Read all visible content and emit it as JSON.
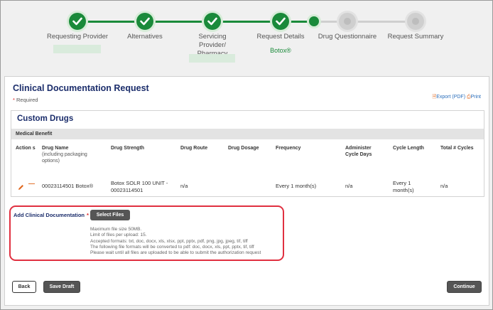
{
  "stepper": {
    "steps": [
      {
        "label": "Requesting Provider",
        "status": "done",
        "sub": ""
      },
      {
        "label": "Alternatives",
        "status": "done",
        "sub": ""
      },
      {
        "label": "Servicing Provider/ Pharmacy",
        "status": "done",
        "sub": ""
      },
      {
        "label": "Request Details",
        "status": "done",
        "sub": "Botox®"
      },
      {
        "label": "Drug Questionnaire",
        "status": "current",
        "sub": ""
      },
      {
        "label": "Request Summary",
        "status": "todo",
        "sub": ""
      }
    ]
  },
  "page": {
    "title": "Clinical Documentation Request",
    "required_note": "Required",
    "export_label": "Export (PDF)",
    "print_label": "Print"
  },
  "custom_drugs": {
    "title": "Custom Drugs",
    "benefit": "Medical Benefit",
    "columns": {
      "actions": "Action s",
      "drug_name": "Drug Name",
      "drug_name_note": "(including packaging options)",
      "strength": "Drug Strength",
      "route": "Drug Route",
      "dosage": "Drug Dosage",
      "frequency": "Frequency",
      "administer": "Administer Cycle Days",
      "cycle_length": "Cycle Length",
      "total_cycles": "Total # Cycles"
    },
    "row": {
      "drug_name": "00023114501 Botox®",
      "strength": "Botox SOLR 100 UNIT - 00023114501",
      "route": "n/a",
      "dosage": "",
      "frequency": "Every 1 month(s)",
      "administer": "n/a",
      "cycle_length": "Every 1 month(s)",
      "total_cycles": "n/a"
    }
  },
  "upload": {
    "label": "Add Clinical Documentation",
    "button": "Select Files",
    "info": [
      "Maximum file size 50MB.",
      "Limit of files per upload: 15.",
      "Accepted formats: txt, doc, docx, xls, xlsx, ppt, pptx, pdf, png, jpg, jpeg, tif, tiff",
      "The following file formats will be converted to pdf: doc, docx, xls, ppt, pptx, tif, tiff",
      "Please wait until all files are uploaded to be able to submit the authorization request"
    ]
  },
  "buttons": {
    "back": "Back",
    "save_draft": "Save Draft",
    "continue": "Continue"
  },
  "colors": {
    "accent_green": "#1a8a3a",
    "title_navy": "#1b2d6b",
    "highlight_red": "#e03040",
    "icon_orange": "#e0671e"
  }
}
